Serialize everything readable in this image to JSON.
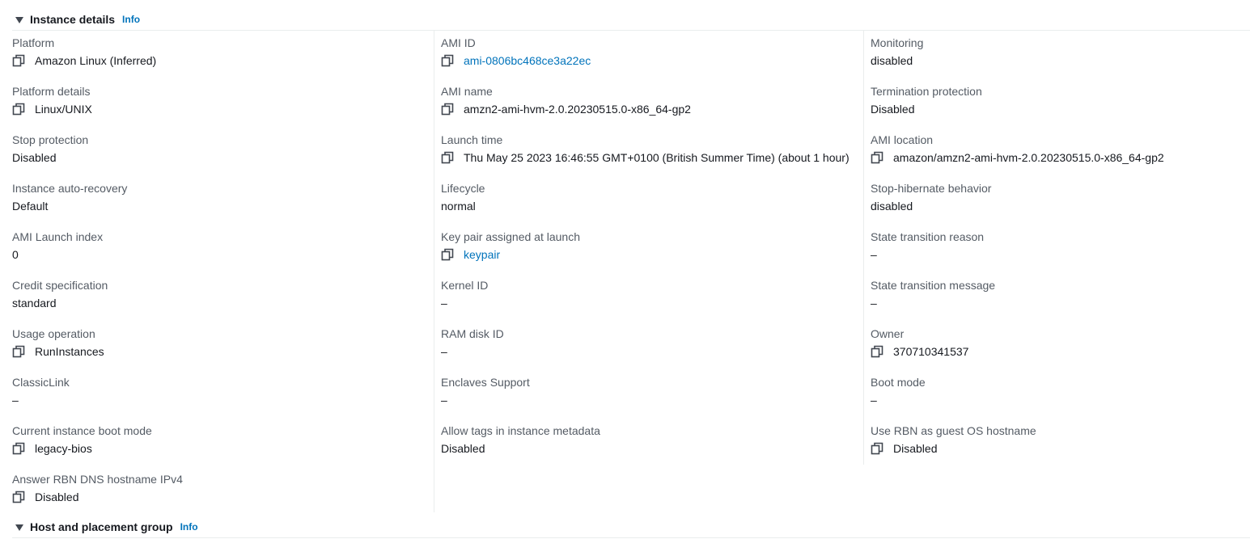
{
  "sections": {
    "instance_details": {
      "title": "Instance details",
      "info": "Info"
    },
    "host_placement": {
      "title": "Host and placement group",
      "info": "Info"
    }
  },
  "columns": [
    [
      {
        "label": "Platform",
        "value": "Amazon Linux (Inferred)",
        "copy": true,
        "link": false
      },
      {
        "label": "Platform details",
        "value": "Linux/UNIX",
        "copy": true,
        "link": false
      },
      {
        "label": "Stop protection",
        "value": "Disabled",
        "copy": false,
        "link": false
      },
      {
        "label": "Instance auto-recovery",
        "value": "Default",
        "copy": false,
        "link": false
      },
      {
        "label": "AMI Launch index",
        "value": "0",
        "copy": false,
        "link": false
      },
      {
        "label": "Credit specification",
        "value": "standard",
        "copy": false,
        "link": false
      },
      {
        "label": "Usage operation",
        "value": "RunInstances",
        "copy": true,
        "link": false
      },
      {
        "label": "ClassicLink",
        "value": "–",
        "copy": false,
        "link": false
      },
      {
        "label": "Current instance boot mode",
        "value": "legacy-bios",
        "copy": true,
        "link": false
      },
      {
        "label": "Answer RBN DNS hostname IPv4",
        "value": "Disabled",
        "copy": true,
        "link": false
      }
    ],
    [
      {
        "label": "AMI ID",
        "value": "ami-0806bc468ce3a22ec",
        "copy": true,
        "link": true
      },
      {
        "label": "AMI name",
        "value": "amzn2-ami-hvm-2.0.20230515.0-x86_64-gp2",
        "copy": true,
        "link": false
      },
      {
        "label": "Launch time",
        "value": "Thu May 25 2023 16:46:55 GMT+0100 (British Summer Time) (about 1 hour)",
        "copy": true,
        "link": false
      },
      {
        "label": "Lifecycle",
        "value": "normal",
        "copy": false,
        "link": false
      },
      {
        "label": "Key pair assigned at launch",
        "value": "keypair",
        "copy": true,
        "link": true
      },
      {
        "label": "Kernel ID",
        "value": "–",
        "copy": false,
        "link": false
      },
      {
        "label": "RAM disk ID",
        "value": "–",
        "copy": false,
        "link": false
      },
      {
        "label": "Enclaves Support",
        "value": "–",
        "copy": false,
        "link": false
      },
      {
        "label": "Allow tags in instance metadata",
        "value": "Disabled",
        "copy": false,
        "link": false
      }
    ],
    [
      {
        "label": "Monitoring",
        "value": "disabled",
        "copy": false,
        "link": false
      },
      {
        "label": "Termination protection",
        "value": "Disabled",
        "copy": false,
        "link": false
      },
      {
        "label": "AMI location",
        "value": "amazon/amzn2-ami-hvm-2.0.20230515.0-x86_64-gp2",
        "copy": true,
        "link": false
      },
      {
        "label": "Stop-hibernate behavior",
        "value": "disabled",
        "copy": false,
        "link": false
      },
      {
        "label": "State transition reason",
        "value": "–",
        "copy": false,
        "link": false
      },
      {
        "label": "State transition message",
        "value": "–",
        "copy": false,
        "link": false
      },
      {
        "label": "Owner",
        "value": "370710341537",
        "copy": true,
        "link": false
      },
      {
        "label": "Boot mode",
        "value": "–",
        "copy": false,
        "link": false
      },
      {
        "label": "Use RBN as guest OS hostname",
        "value": "Disabled",
        "copy": true,
        "link": false
      }
    ]
  ],
  "icons": {
    "copy": "copy-icon",
    "caret": "caret-down-icon"
  },
  "colors": {
    "link": "#0073bb",
    "label": "#545b64",
    "text": "#16191f",
    "divider": "#eaeded"
  }
}
